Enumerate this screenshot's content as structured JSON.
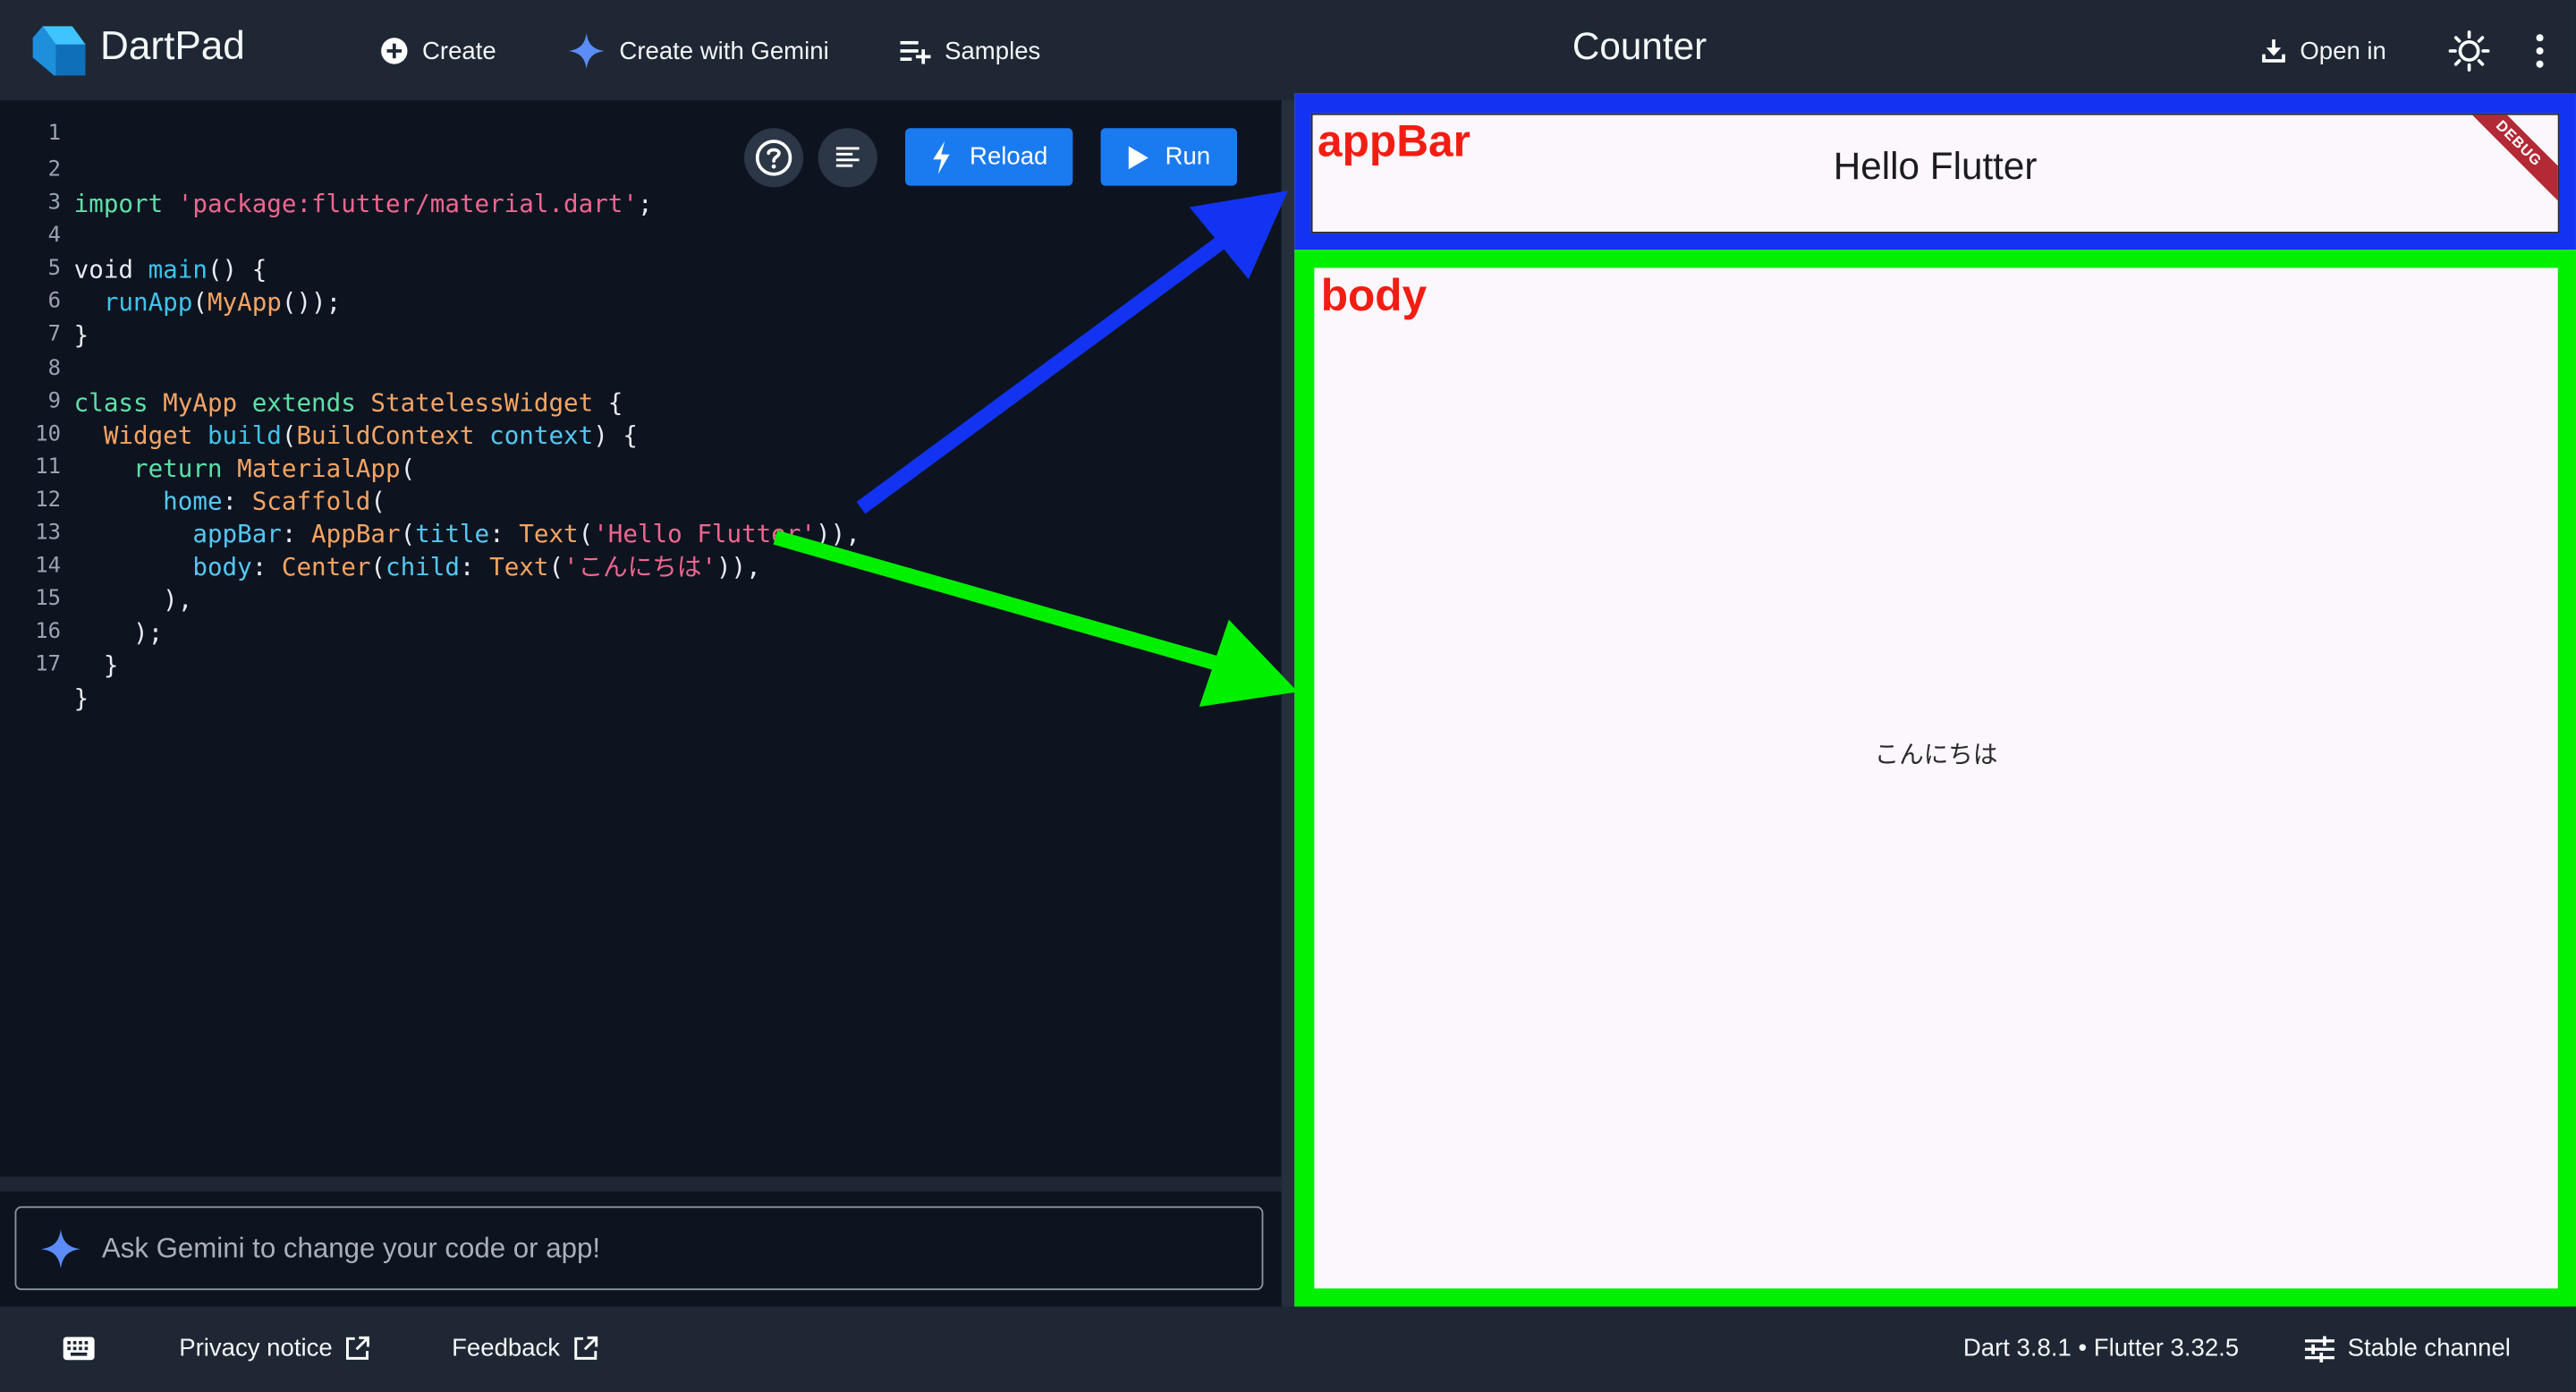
{
  "header": {
    "brand": "DartPad",
    "nav": {
      "create": "Create",
      "create_gemini": "Create with Gemini",
      "samples": "Samples"
    },
    "title": "Counter",
    "open_in": "Open in"
  },
  "editor": {
    "reload_label": "Reload",
    "run_label": "Run",
    "gemini_placeholder": "Ask Gemini to change your code or app!",
    "line_numbers": [
      "1",
      "2",
      "3",
      "4",
      "5",
      "6",
      "7",
      "8",
      "9",
      "10",
      "11",
      "12",
      "13",
      "14",
      "15",
      "16",
      "17"
    ],
    "code": {
      "l2": {
        "import": "import",
        "path": "'package:flutter/material.dart'",
        "end": ";"
      },
      "l4": {
        "void": "void",
        "main": "main",
        "rest": "() {"
      },
      "l5": {
        "runApp": "runApp",
        "p1": "(",
        "MyApp": "MyApp",
        "p2": "());"
      },
      "l6": "}",
      "l8": {
        "class": "class",
        "MyApp": "MyApp",
        "extends": "extends",
        "SW": "StatelessWidget",
        "brace": "{"
      },
      "l9": {
        "Widget": "Widget",
        "build": "build",
        "p1": "(",
        "BC": "BuildContext",
        "context": "context",
        "p2": ") {"
      },
      "l10": {
        "return": "return",
        "MA": "MaterialApp",
        "p": "("
      },
      "l11": {
        "home": "home",
        "colon": ": ",
        "Scaffold": "Scaffold",
        "p": "("
      },
      "l12": {
        "appBar": "appBar",
        "colon": ": ",
        "AppBar": "AppBar",
        "p1": "(",
        "title": "title",
        "colon2": ": ",
        "Text": "Text",
        "p2": "(",
        "str": "'Hello Flutter'",
        "p3": ")),"
      },
      "l13": {
        "body": "body",
        "colon": ": ",
        "Center": "Center",
        "p1": "(",
        "child": "child",
        "colon2": ": ",
        "Text": "Text",
        "p2": "(",
        "str": "'こんにちは'",
        "p3": ")),"
      },
      "l14": "),",
      "l15": ");",
      "l16": "}",
      "l17": "}"
    }
  },
  "preview": {
    "appbar_title": "Hello Flutter",
    "debug_banner": "DEBUG",
    "body_text": "こんにちは",
    "annotations": {
      "appbar_label": "appBar",
      "body_label": "body"
    },
    "colors": {
      "appbar_highlight": "#1233f2",
      "body_highlight": "#00f000",
      "label_red": "#f21d12"
    }
  },
  "footer": {
    "privacy": "Privacy notice",
    "feedback": "Feedback",
    "version": "Dart 3.8.1 • Flutter 3.32.5",
    "channel": "Stable channel"
  },
  "icons": [
    "dart-logo-icon",
    "add-circle-icon",
    "gemini-sparkle-icon",
    "playlist-add-icon",
    "download-icon",
    "brightness-icon",
    "more-vert-icon",
    "help-icon",
    "format-icon",
    "bolt-icon",
    "play-icon",
    "keyboard-icon",
    "external-link-icon",
    "tune-icon"
  ]
}
